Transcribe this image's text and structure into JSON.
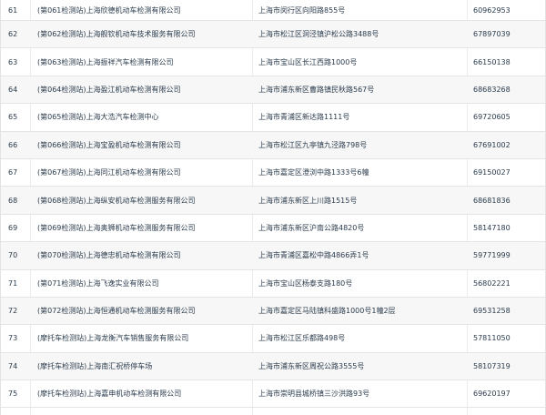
{
  "table": {
    "rows": [
      {
        "no": "61",
        "name": "(第061检测站)上海欣德机动车检测有限公司",
        "address": "上海市闵行区向阳路855号",
        "phone": "60962953"
      },
      {
        "no": "62",
        "name": "(第062检测站)上海舰钦机动车技术服务有限公司",
        "address": "上海市松江区洞泾镇沪松公路3488号",
        "phone": "67897039"
      },
      {
        "no": "63",
        "name": "(第063检测站)上海振祥汽车检测有限公司",
        "address": "上海市宝山区长江西路1000号",
        "phone": "66150138"
      },
      {
        "no": "64",
        "name": "(第064检测站)上海盈江机动车检测有限公司",
        "address": "上海市浦东新区曹路镇民秋路567号",
        "phone": "68683268"
      },
      {
        "no": "65",
        "name": "(第065检测站)上海大浩汽车检测中心",
        "address": "上海市青浦区新达路1111号",
        "phone": "69720605"
      },
      {
        "no": "66",
        "name": "(第066检测站)上海宝盈机动车检测有限公司",
        "address": "上海市松江区九亭镇九泾路798号",
        "phone": "67691002"
      },
      {
        "no": "67",
        "name": "(第067检测站)上海同江机动车检测有限公司",
        "address": "上海市嘉定区澄浏中路1333号6幢",
        "phone": "69150027"
      },
      {
        "no": "68",
        "name": "(第068检测站)上海纵安机动车检测服务有限公司",
        "address": "上海市浦东新区上川路1515号",
        "phone": "68681836"
      },
      {
        "no": "69",
        "name": "(第069检测站)上海奥狮机动车检测服务有限公司",
        "address": "上海市浦东新区沪南公路4820号",
        "phone": "58147180"
      },
      {
        "no": "70",
        "name": "(第070检测站)上海德忠机动车检测有限公司",
        "address": "上海市青浦区嘉松中路4866弄1号",
        "phone": "59771999"
      },
      {
        "no": "71",
        "name": "(第071检测站)上海飞逸实业有限公司",
        "address": "上海市宝山区杨泰支路180号",
        "phone": "56802221"
      },
      {
        "no": "72",
        "name": "(第072检测站)上海恒通机动车检测服务有限公司",
        "address": "上海市嘉定区马陆镇科盛路1000号1幢2层",
        "phone": "69531258"
      },
      {
        "no": "73",
        "name": "(摩托车检测站)上海龙衡汽车销售服务有限公司",
        "address": "上海市松江区乐都路498号",
        "phone": "57811050"
      },
      {
        "no": "74",
        "name": "(摩托车检测站)上海南汇祝桥停车场",
        "address": "上海市浦东新区周祝公路3555号",
        "phone": "58107319"
      },
      {
        "no": "75",
        "name": "(摩托车检测站)上海嘉申机动车检测有限公司",
        "address": "上海市崇明县城桥镇三沙洪路93号",
        "phone": "69620197"
      }
    ]
  }
}
